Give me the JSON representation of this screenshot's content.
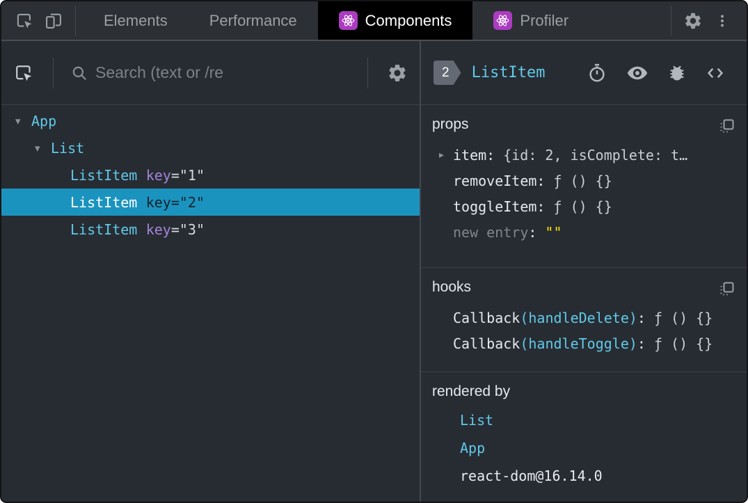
{
  "colors": {
    "accent": "#61c9e8",
    "attr_purple": "#a583d6",
    "selected_bg": "#1b93bf",
    "yellow": "#ffe000",
    "react_purple": "#ab3cc0",
    "bg": "#272c33",
    "bg_topbar": "#2c2f34",
    "border": "#45484e",
    "border_soft": "#3c4046",
    "icon_gray": "#9aa0a6"
  },
  "topbar": {
    "tabs": [
      {
        "label": "Elements"
      },
      {
        "label": "Performance"
      },
      {
        "label": "Components"
      },
      {
        "label": "Profiler"
      }
    ]
  },
  "left_panel": {
    "search_placeholder": "Search (text or /re",
    "tree": [
      {
        "arrow": "▾",
        "label": "App"
      },
      {
        "arrow": "▾",
        "label": "List"
      },
      {
        "label": "ListItem",
        "key_attr": "key",
        "key_eq": "=\"1\""
      },
      {
        "label": "ListItem",
        "key_attr": "key",
        "key_eq": "=\"2\""
      },
      {
        "label": "ListItem",
        "key_attr": "key",
        "key_eq": "=\"3\""
      }
    ]
  },
  "right_panel": {
    "badge": "2",
    "title": "ListItem",
    "props": {
      "title": "props",
      "rows": [
        {
          "arrow": "▸",
          "name": "item",
          "colon": ":",
          "value": "{id: 2, isComplete: t…"
        },
        {
          "arrow": "",
          "name": "removeItem",
          "colon": ":",
          "value": "ƒ () {}"
        },
        {
          "arrow": "",
          "name": "toggleItem",
          "colon": ":",
          "value": "ƒ () {}"
        }
      ],
      "new_entry": {
        "label": "new entry",
        "colon": ":",
        "value": "\"\""
      }
    },
    "hooks": {
      "title": "hooks",
      "rows": [
        {
          "name": "Callback",
          "paren": "(handleDelete)",
          "colon": ":",
          "value": "ƒ () {}"
        },
        {
          "name": "Callback",
          "paren": "(handleToggle)",
          "colon": ":",
          "value": "ƒ () {}"
        }
      ]
    },
    "rendered_by": {
      "title": "rendered by",
      "items": [
        {
          "label": "List"
        },
        {
          "label": "App"
        },
        {
          "label": "react-dom@16.14.0"
        }
      ]
    }
  }
}
